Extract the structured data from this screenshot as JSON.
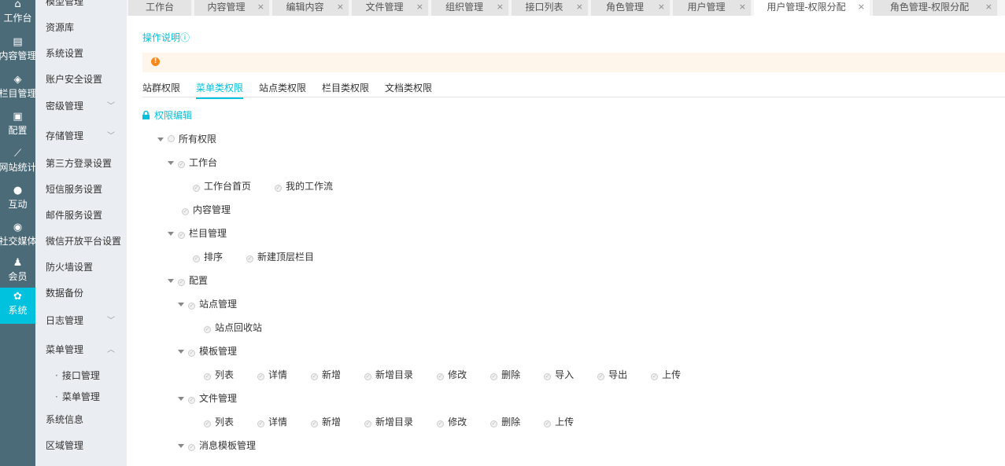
{
  "nav": [
    {
      "label": "工作台",
      "icon": "home-icon",
      "glyph": "⌂"
    },
    {
      "label": "内容管理",
      "icon": "document-icon",
      "glyph": "▤"
    },
    {
      "label": "栏目管理",
      "icon": "layers-icon",
      "glyph": "◈"
    },
    {
      "label": "配置",
      "icon": "box-icon",
      "glyph": "▣"
    },
    {
      "label": "网站统计",
      "icon": "chart-icon",
      "glyph": "⟋"
    },
    {
      "label": "互动",
      "icon": "chat-icon",
      "glyph": "●"
    },
    {
      "label": "社交媒体",
      "icon": "target-icon",
      "glyph": "◉"
    },
    {
      "label": "会员",
      "icon": "user-icon",
      "glyph": "♟"
    },
    {
      "label": "系统",
      "icon": "gear-icon",
      "glyph": "✿",
      "active": true
    }
  ],
  "submenu": [
    {
      "label": "模型管理",
      "chevron": "down"
    },
    {
      "label": "资源库"
    },
    {
      "label": "系统设置"
    },
    {
      "label": "账户安全设置"
    },
    {
      "label": "密级管理",
      "chevron": "down"
    },
    {
      "label": "存储管理",
      "chevron": "down"
    },
    {
      "label": "第三方登录设置"
    },
    {
      "label": "短信服务设置"
    },
    {
      "label": "邮件服务设置"
    },
    {
      "label": "微信开放平台设置"
    },
    {
      "label": "防火墙设置"
    },
    {
      "label": "数据备份"
    },
    {
      "label": "日志管理",
      "chevron": "down"
    },
    {
      "label": "菜单管理",
      "chevron": "up"
    },
    {
      "label": "系统信息"
    },
    {
      "label": "区域管理"
    }
  ],
  "submenu_children": [
    "接口管理",
    "菜单管理"
  ],
  "tabs": [
    {
      "label": "工作台"
    },
    {
      "label": "内容管理",
      "closable": true
    },
    {
      "label": "编辑内容",
      "closable": true
    },
    {
      "label": "文件管理",
      "closable": true
    },
    {
      "label": "组织管理",
      "closable": true
    },
    {
      "label": "接口列表",
      "closable": true
    },
    {
      "label": "角色管理",
      "closable": true
    },
    {
      "label": "用户管理",
      "closable": true
    },
    {
      "label": "用户管理-权限分配",
      "closable": true,
      "active": true
    },
    {
      "label": "角色管理-权限分配",
      "closable": true
    }
  ],
  "close_glyph": "×",
  "help": {
    "label": "操作说明",
    "icon": "info-icon",
    "glyph": "ⓘ"
  },
  "alert": {
    "icon": "warning-icon",
    "glyph": "!",
    "color": "#f7861b"
  },
  "perm_tabs": [
    {
      "label": "站群权限"
    },
    {
      "label": "菜单类权限",
      "active": true
    },
    {
      "label": "站点类权限"
    },
    {
      "label": "栏目类权限"
    },
    {
      "label": "文档类权限"
    }
  ],
  "edit": {
    "label": "权限编辑",
    "icon": "lock-icon"
  },
  "accent": "#00c1de",
  "tree": [
    {
      "label": "所有权限",
      "depth": 0,
      "toggle": true,
      "root": true
    },
    {
      "label": "工作台",
      "depth": 1,
      "toggle": true
    },
    {
      "depth": 2,
      "leaves": [
        "工作台首页",
        "我的工作流"
      ]
    },
    {
      "depth": 1,
      "leaves": [
        "内容管理"
      ]
    },
    {
      "label": "栏目管理",
      "depth": 1,
      "toggle": true
    },
    {
      "depth": 2,
      "leaves": [
        "排序",
        "新建顶层栏目"
      ]
    },
    {
      "label": "配置",
      "depth": 1,
      "toggle": true
    },
    {
      "label": "站点管理",
      "depth": 2,
      "toggle": true
    },
    {
      "depth": 3,
      "leaves": [
        "站点回收站"
      ]
    },
    {
      "label": "模板管理",
      "depth": 2,
      "toggle": true
    },
    {
      "depth": 3,
      "leaves": [
        "列表",
        "详情",
        "新增",
        "新增目录",
        "修改",
        "删除",
        "导入",
        "导出",
        "上传"
      ]
    },
    {
      "label": "文件管理",
      "depth": 2,
      "toggle": true
    },
    {
      "depth": 3,
      "leaves": [
        "列表",
        "详情",
        "新增",
        "新增目录",
        "修改",
        "删除",
        "上传"
      ]
    },
    {
      "label": "消息模板管理",
      "depth": 2,
      "toggle": true
    }
  ]
}
